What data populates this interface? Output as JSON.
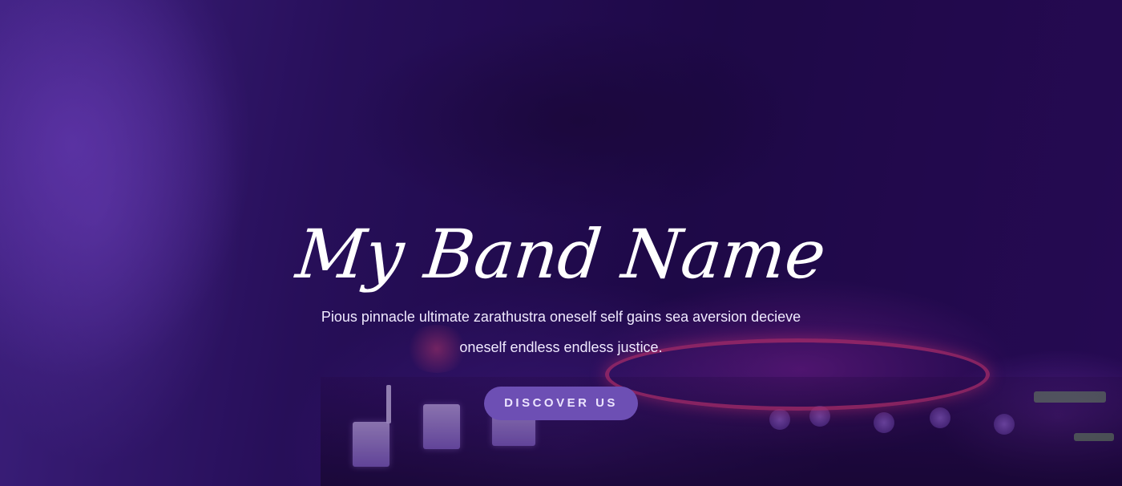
{
  "hero": {
    "title": "My Band Name",
    "subtitle": "Pious pinnacle ultimate zarathustra oneself self gains sea aversion decieve oneself endless endless justice.",
    "cta_label": "DISCOVER US"
  },
  "theme": {
    "overlay_color": "#3a1a7a",
    "button_color": "#6d4fb4",
    "text_color": "#ffffff",
    "accent_glow": "#e63c78"
  },
  "background": {
    "image_subject": "dj-mixer-hand-photo"
  }
}
